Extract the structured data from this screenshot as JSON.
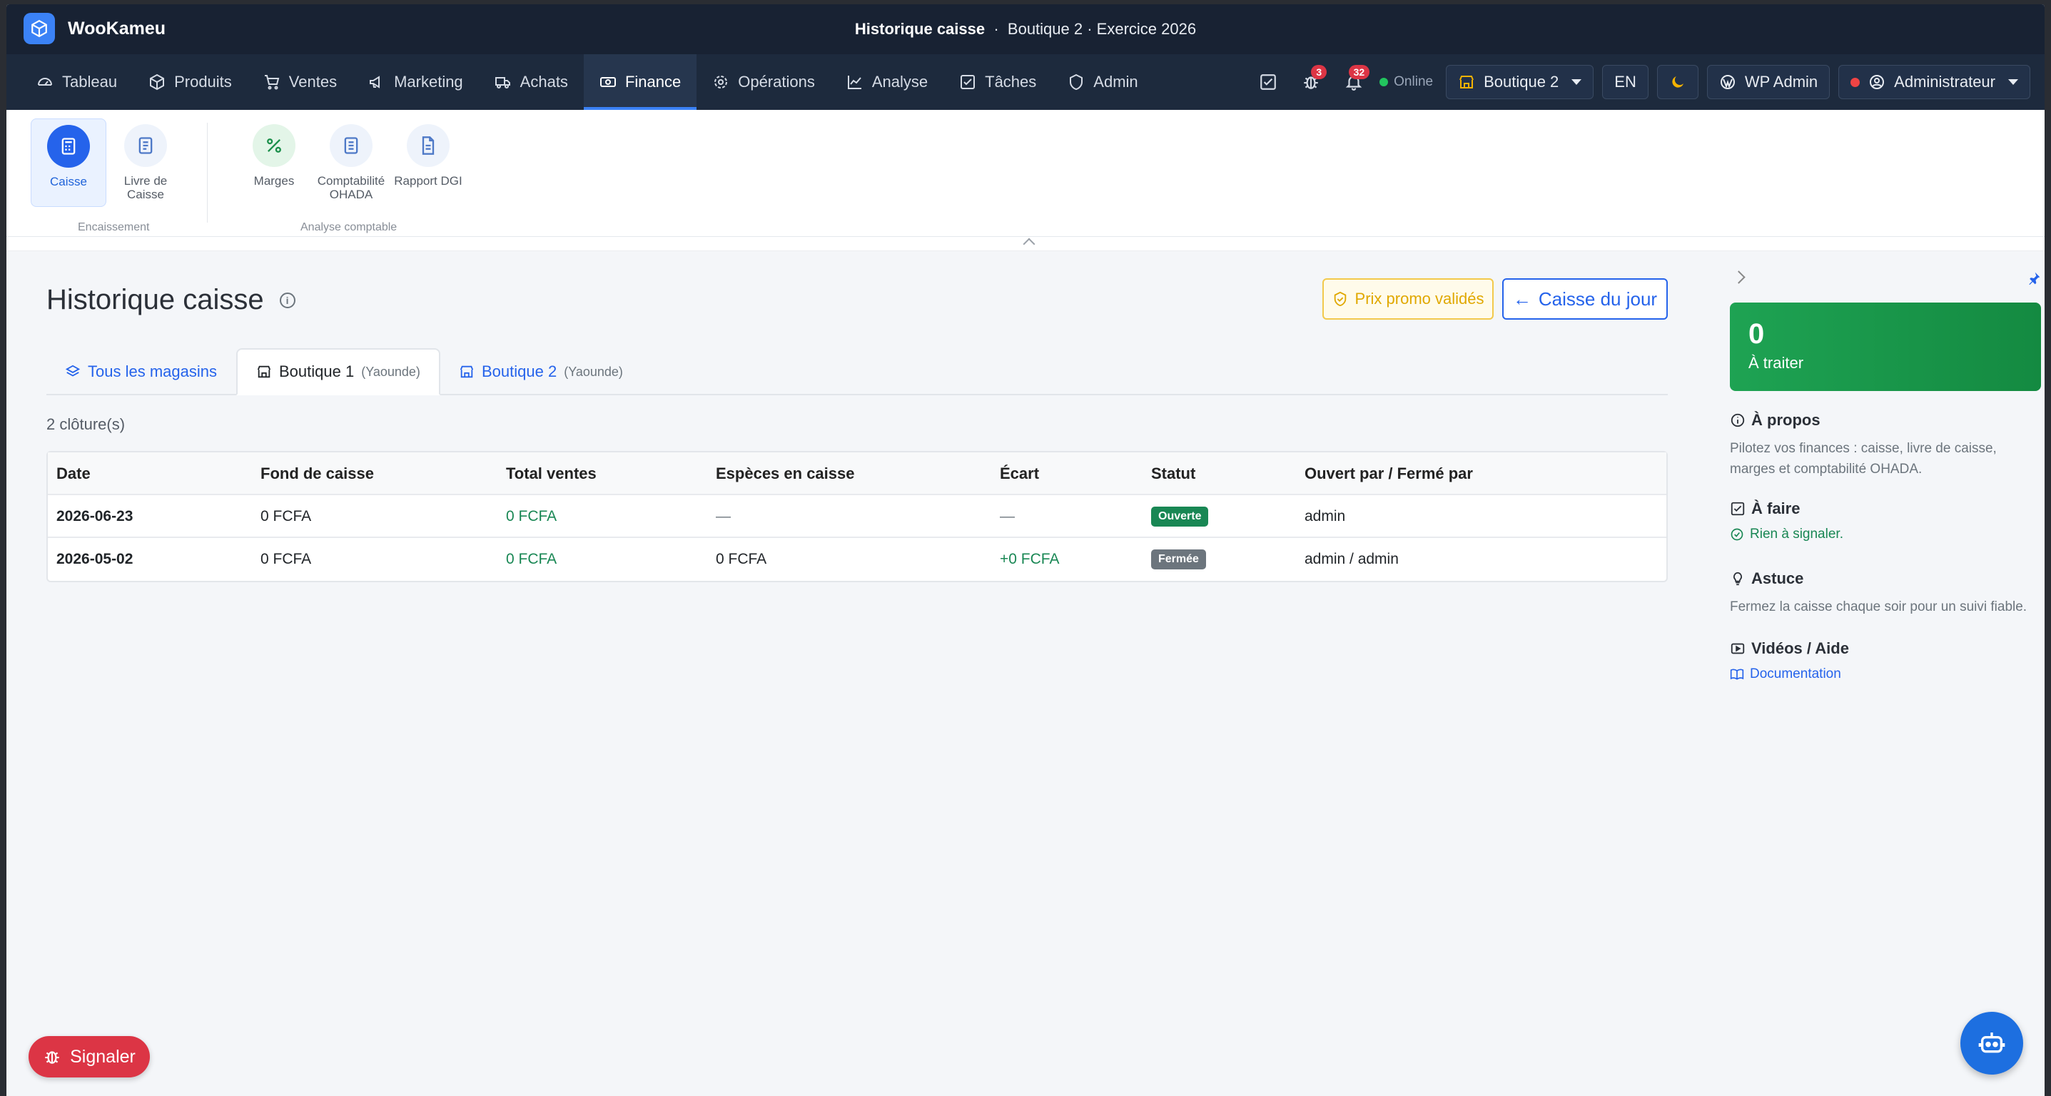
{
  "app": {
    "name": "WooKameu"
  },
  "window_title": {
    "page": "Historique caisse",
    "context": "Boutique 2 · Exercice 2026"
  },
  "nav": {
    "items": [
      {
        "label": "Tableau",
        "icon": "gauge-icon"
      },
      {
        "label": "Produits",
        "icon": "box-icon"
      },
      {
        "label": "Ventes",
        "icon": "cart-icon"
      },
      {
        "label": "Marketing",
        "icon": "megaphone-icon"
      },
      {
        "label": "Achats",
        "icon": "truck-icon"
      },
      {
        "label": "Finance",
        "icon": "cash-icon",
        "active": true
      },
      {
        "label": "Opérations",
        "icon": "gear-icon"
      },
      {
        "label": "Analyse",
        "icon": "chart-line-icon"
      },
      {
        "label": "Tâches",
        "icon": "checkbox-icon"
      },
      {
        "label": "Admin",
        "icon": "shield-icon"
      }
    ],
    "bug_count": "3",
    "notif_count": "32",
    "online_label": "Online",
    "store_selector": "Boutique 2",
    "lang": "EN",
    "wp_admin": "WP Admin",
    "user": "Administrateur"
  },
  "ribbon": {
    "groups": [
      {
        "label": "Encaissement",
        "items": [
          {
            "label": "Caisse",
            "active": true
          },
          {
            "label": "Livre de Caisse"
          }
        ]
      },
      {
        "label": "Analyse comptable",
        "items": [
          {
            "label": "Marges"
          },
          {
            "label": "Comptabilité OHADA"
          },
          {
            "label": "Rapport DGI"
          }
        ]
      }
    ]
  },
  "main": {
    "title": "Historique caisse",
    "promo_button": "Prix promo validés",
    "caisse_button": "Caisse du jour",
    "tabs": [
      {
        "label": "Tous les magasins",
        "sub": ""
      },
      {
        "label": "Boutique 1",
        "sub": "(Yaounde)",
        "active": true
      },
      {
        "label": "Boutique 2",
        "sub": "(Yaounde)"
      }
    ],
    "count": "2 clôture(s)",
    "table": {
      "headers": [
        "Date",
        "Fond de caisse",
        "Total ventes",
        "Espèces en caisse",
        "Écart",
        "Statut",
        "Ouvert par / Fermé par"
      ],
      "rows": [
        {
          "date": "2026-06-23",
          "fond": "0 FCFA",
          "total": "0 FCFA",
          "especes": "—",
          "ecart": "—",
          "statut": "Ouverte",
          "par": "admin"
        },
        {
          "date": "2026-05-02",
          "fond": "0 FCFA",
          "total": "0 FCFA",
          "especes": "0 FCFA",
          "ecart": "+0 FCFA",
          "statut": "Fermée",
          "par": "admin / admin"
        }
      ]
    }
  },
  "sidebar": {
    "kpi_value": "0",
    "kpi_label": "À traiter",
    "about_title": "À propos",
    "about_text": "Pilotez vos finances : caisse, livre de caisse, marges et comptabilité OHADA.",
    "todo_title": "À faire",
    "todo_text": "Rien à signaler.",
    "tip_title": "Astuce",
    "tip_text": "Fermez la caisse chaque soir pour un suivi fiable.",
    "videos_title": "Vidéos / Aide",
    "doc_link": "Documentation"
  },
  "floating": {
    "report_button": "Signaler"
  },
  "colors": {
    "accent": "#2563eb",
    "topbar": "#182233",
    "navbar": "#1d2a3d",
    "success": "#198754",
    "danger": "#dc3545",
    "warning": "#e0a800"
  }
}
